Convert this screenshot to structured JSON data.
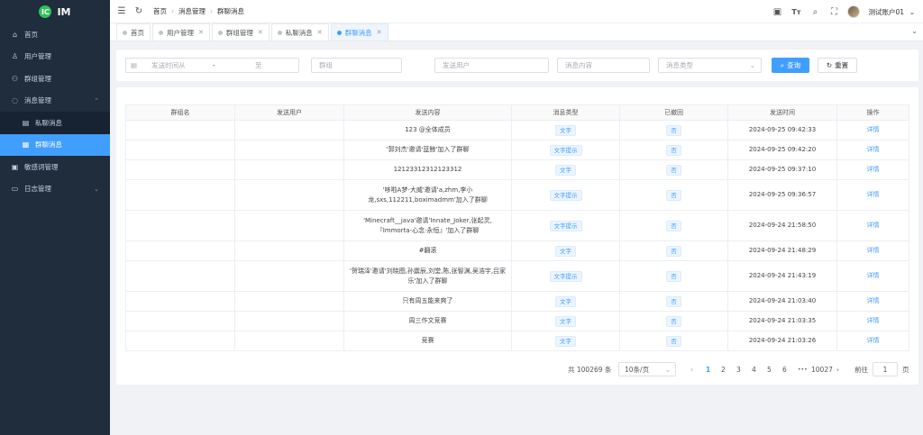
{
  "app": {
    "logo_mark": "IC",
    "title": "IM"
  },
  "sidebar": {
    "items": [
      {
        "label": "首页",
        "icon": "home-icon",
        "glyph": "⌂",
        "level": 0
      },
      {
        "label": "用户管理",
        "icon": "user-icon",
        "glyph": "♙",
        "level": 0
      },
      {
        "label": "群组管理",
        "icon": "group-icon",
        "glyph": "⚇",
        "level": 0
      },
      {
        "label": "消息管理",
        "icon": "message-icon",
        "glyph": "◌",
        "level": 0,
        "chevron": "⌃",
        "expanded": true
      },
      {
        "label": "私聊消息",
        "icon": "private-chat-icon",
        "glyph": "▤",
        "level": 1
      },
      {
        "label": "群聊消息",
        "icon": "group-chat-icon",
        "glyph": "▦",
        "level": 1,
        "active": true
      },
      {
        "label": "敏感词管理",
        "icon": "sensitive-word-icon",
        "glyph": "▣",
        "level": 0
      },
      {
        "label": "日志管理",
        "icon": "log-icon",
        "glyph": "▭",
        "level": 0,
        "chevron": "⌄"
      }
    ]
  },
  "topbar": {
    "breadcrumb": [
      "首页",
      "消息管理",
      "群聊消息"
    ],
    "user_name": "测试账户01"
  },
  "tabs": [
    {
      "label": "首页",
      "closable": false
    },
    {
      "label": "用户管理",
      "closable": true
    },
    {
      "label": "群组管理",
      "closable": true
    },
    {
      "label": "私聊消息",
      "closable": true
    },
    {
      "label": "群聊消息",
      "closable": true,
      "active": true
    }
  ],
  "filters": {
    "start_placeholder": "发送时间从",
    "range_dash": "-",
    "end_placeholder": "至",
    "group_placeholder": "群组",
    "sender_placeholder": "发送用户",
    "content_placeholder": "消息内容",
    "type_placeholder": "消息类型",
    "query_label": "查询",
    "reset_label": "重置"
  },
  "table": {
    "headers": [
      "群组名",
      "发送用户",
      "发送内容",
      "消息类型",
      "已撤回",
      "发送时间",
      "操作"
    ],
    "rows": [
      {
        "group": "",
        "sender": "",
        "content": "123 @全体成员",
        "type": "文字",
        "recalled": "否",
        "time": "2024-09-25 09:42:33",
        "action": "详情"
      },
      {
        "group": "",
        "sender": "",
        "content": "'郭刘杰'邀请'蓝鲸'加入了群聊",
        "type": "文字提示",
        "recalled": "否",
        "time": "2024-09-25 09:42:20",
        "action": "详情"
      },
      {
        "group": "",
        "sender": "",
        "content": "12123312312123312",
        "type": "文字",
        "recalled": "否",
        "time": "2024-09-25 09:37:10",
        "action": "详情"
      },
      {
        "group": "",
        "sender": "",
        "content": "'哆啦A梦-大威'邀请'a,zhm,李小龙,sxs,112211,boximadmm'加入了群聊",
        "type": "文字提示",
        "recalled": "否",
        "time": "2024-09-25 09:36:57",
        "action": "详情"
      },
      {
        "group": "",
        "sender": "",
        "content": "'Minecraft__java'邀请'Innate_Joker,张起灵,『Immorta-心念·永恒』'加入了群聊",
        "type": "文字提示",
        "recalled": "否",
        "time": "2024-09-24 21:58:50",
        "action": "详情"
      },
      {
        "group": "",
        "sender": "",
        "content": "#翻滚",
        "type": "文字",
        "recalled": "否",
        "time": "2024-09-24 21:48:29",
        "action": "详情"
      },
      {
        "group": "",
        "sender": "",
        "content": "'贺瑞泽'邀请'刘晓图,孙震辰,刘堂,陈,张智渊,吴浩宇,吕家乐'加入了群聊",
        "type": "文字提示",
        "recalled": "否",
        "time": "2024-09-24 21:43:19",
        "action": "详情"
      },
      {
        "group": "",
        "sender": "",
        "content": "只有周五能来爽了",
        "type": "文字",
        "recalled": "否",
        "time": "2024-09-24 21:03:40",
        "action": "详情"
      },
      {
        "group": "",
        "sender": "",
        "content": "周三作文竞赛",
        "type": "文字",
        "recalled": "否",
        "time": "2024-09-24 21:03:35",
        "action": "详情"
      },
      {
        "group": "",
        "sender": "",
        "content": "竞赛",
        "type": "文字",
        "recalled": "否",
        "time": "2024-09-24 21:03:26",
        "action": "详情"
      }
    ]
  },
  "pagination": {
    "total_text": "共 100269 条",
    "page_size": "10条/页",
    "pages": [
      "1",
      "2",
      "3",
      "4",
      "5",
      "6"
    ],
    "current_page": "1",
    "ellipsis": "•••",
    "last_page": "10027",
    "jump_label": "前往",
    "jump_value": "1",
    "page_suffix": "页"
  },
  "colors": {
    "primary": "#409eff",
    "sidebar_bg": "#1f2d3d",
    "logo": "#2fc25b"
  }
}
